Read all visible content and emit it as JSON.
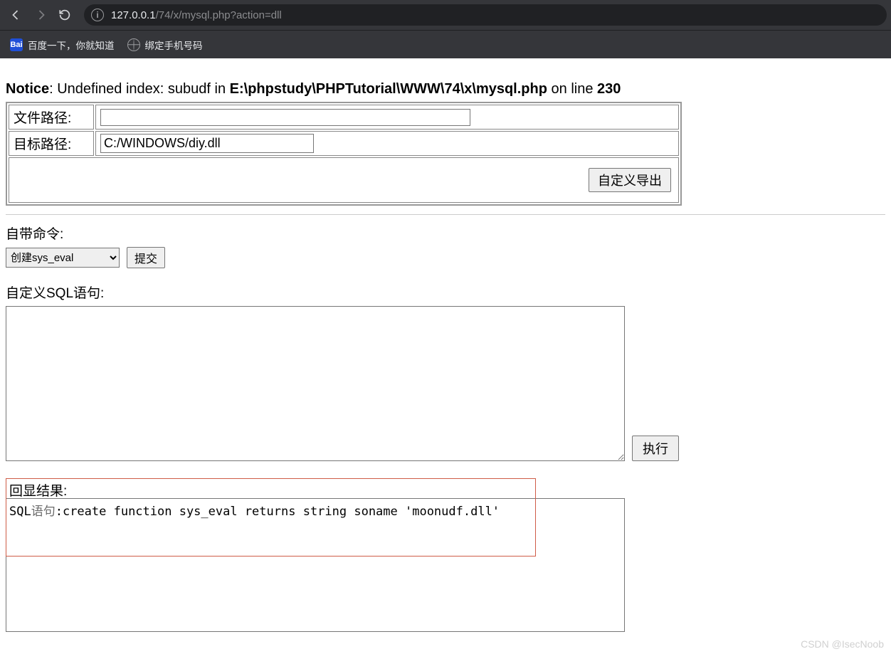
{
  "browser": {
    "url_host": "127.0.0.1",
    "url_path": "/74/x/mysql.php?action=dll",
    "bookmarks": {
      "baidu": "百度一下，你就知道",
      "bind_phone": "绑定手机号码"
    }
  },
  "notice": {
    "prefix_bold": "Notice",
    "text_before_file": ": Undefined index: subudf in ",
    "file_bold": "E:\\phpstudy\\PHPTutorial\\WWW\\74\\x\\mysql.php",
    "text_before_line": " on line ",
    "line_bold": "230"
  },
  "form": {
    "file_path_label": "文件路径:",
    "file_path_value": "",
    "target_path_label": "目标路径:",
    "target_path_value": "C:/WINDOWS/diy.dll",
    "export_button": "自定义导出"
  },
  "commands": {
    "label": "自带命令:",
    "selected": "创建sys_eval",
    "submit": "提交"
  },
  "sql": {
    "label": "自定义SQL语句:",
    "value": "",
    "execute": "执行"
  },
  "result": {
    "title": "回显结果:",
    "sql_label": "SQL",
    "sql_grey": "语句",
    "sql_text": ":create function sys_eval returns string soname 'moonudf.dll'"
  },
  "watermark": "CSDN @IsecNoob"
}
